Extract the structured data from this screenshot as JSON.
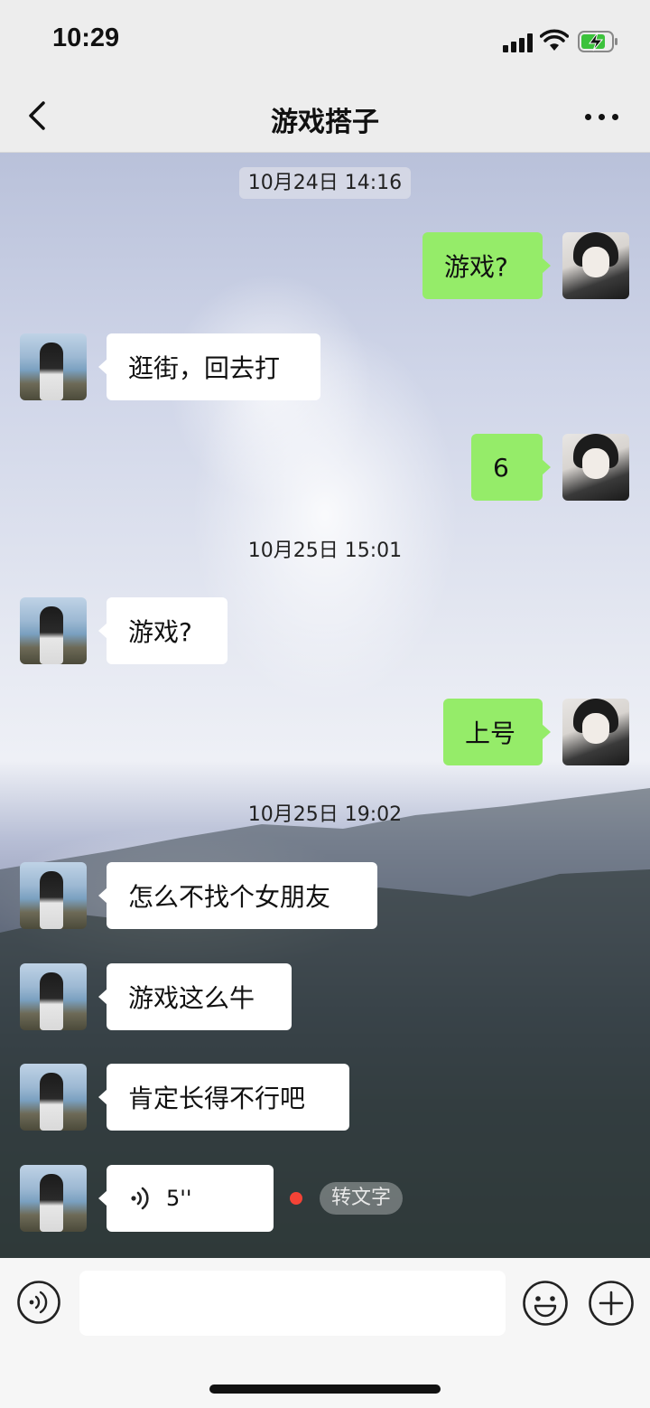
{
  "status_bar": {
    "time": "10:29"
  },
  "nav": {
    "title": "游戏搭子"
  },
  "messages": [
    {
      "type": "time",
      "text": "10月24日 14:16"
    },
    {
      "type": "text",
      "side": "right",
      "text": "游戏?"
    },
    {
      "type": "text",
      "side": "left",
      "text": "逛街，回去打"
    },
    {
      "type": "text",
      "side": "right",
      "text": "6"
    },
    {
      "type": "time",
      "text": "10月25日 15:01"
    },
    {
      "type": "text",
      "side": "left",
      "text": "游戏?"
    },
    {
      "type": "text",
      "side": "right",
      "text": "上号"
    },
    {
      "type": "time",
      "text": "10月25日 19:02"
    },
    {
      "type": "text",
      "side": "left",
      "text": "怎么不找个女朋友"
    },
    {
      "type": "text",
      "side": "left",
      "text": "游戏这么牛"
    },
    {
      "type": "text",
      "side": "left",
      "text": "肯定长得不行吧"
    },
    {
      "type": "voice",
      "side": "left",
      "duration": "5''",
      "unread": true,
      "transcribe_label": "转文字"
    }
  ],
  "input_bar": {
    "text_value": ""
  },
  "colors": {
    "sent_bubble": "#95ec69",
    "received_bubble": "#ffffff",
    "unread_dot": "#f44336"
  }
}
